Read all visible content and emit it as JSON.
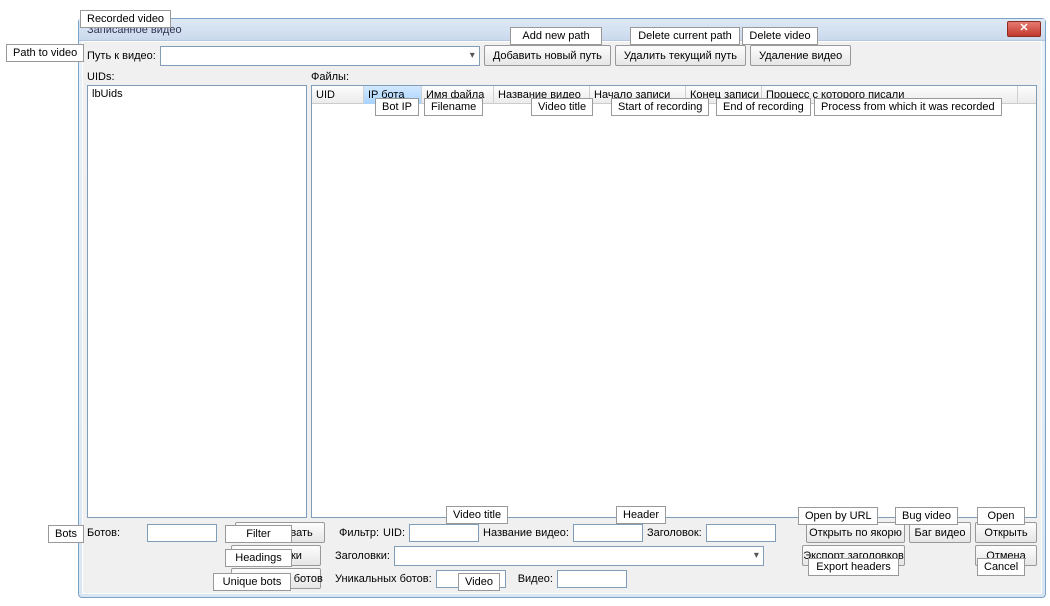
{
  "external_labels": {
    "recorded_video": "Recorded video",
    "path_to_video": "Path to video",
    "bots": "Bots"
  },
  "window": {
    "title": "Записанное видео",
    "close_glyph": "✕"
  },
  "toolbar": {
    "path_label": "Путь к видео:",
    "add_path_ru": "Добавить новый путь",
    "add_path_en": "Add new path",
    "del_cur_ru": "Удалить текущий путь",
    "del_cur_en": "Delete current path",
    "del_vid_ru": "Удаление видео",
    "del_vid_en": "Delete video"
  },
  "uids_panel": {
    "label": "UIDs:",
    "item0": "lbUids"
  },
  "files_panel": {
    "label": "Файлы:",
    "headers": {
      "uid": "UID",
      "ip_ru": "IP бота",
      "ip_en": "Bot IP",
      "fname_ru": "Имя файла",
      "fname_en": "Filename",
      "vtitle_ru": "Название видео",
      "vtitle_en": "Video title",
      "start_ru": "Начало записи",
      "start_en": "Start of recording",
      "end_ru": "Конец записи",
      "end_en": "End of recording",
      "proc_ru": "Процесс с которого писали",
      "proc_en": "Process from which it was recorded"
    }
  },
  "bottom": {
    "bots_label": "Ботов:",
    "filter_btn_ru": "Фильтровать",
    "filter_btn_en": "Filter",
    "headings_btn_ru": "Заголовки",
    "headings_btn_en": "Headings",
    "unique_btn_ru": "Уникальных ботов",
    "unique_btn_en": "Unique bots",
    "filter_label": "Фильтр:",
    "uid_label": "UID:",
    "vtitle_label": "Название видео:",
    "vtitle_en": "Video title",
    "header_label": "Заголовок:",
    "header_en": "Header",
    "headings_label": "Заголовки:",
    "unique_label": "Уникальных ботов:",
    "video_label": "Видео:",
    "video_en": "Video",
    "open_url_ru": "Открыть по якорю",
    "open_url_en": "Open by URL",
    "bug_ru": "Баг видео",
    "bug_en": "Bug video",
    "open_ru": "Открыть",
    "open_en": "Open",
    "export_ru": "Экспорт заголовков",
    "export_en": "Export headers",
    "cancel_ru": "Отмена",
    "cancel_en": "Cancel"
  }
}
